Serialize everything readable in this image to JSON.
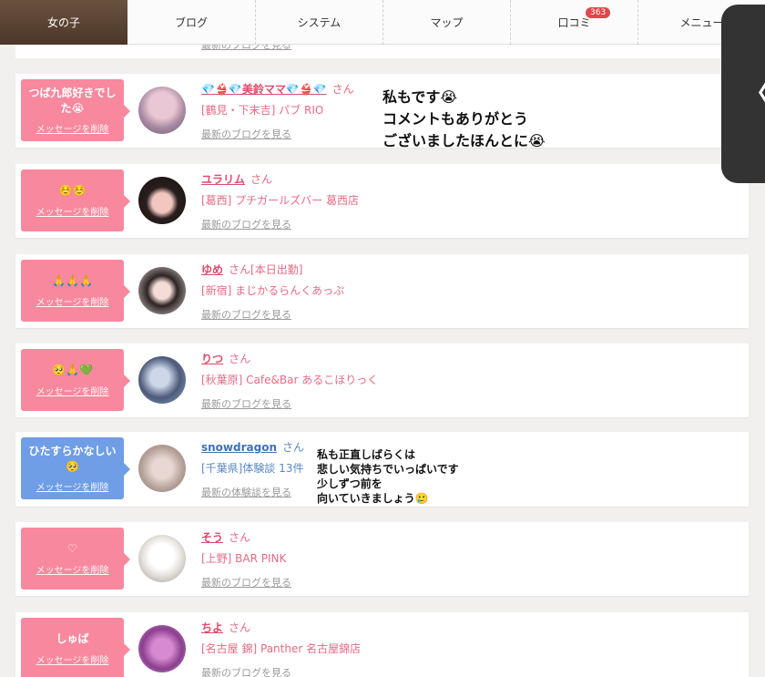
{
  "nav": {
    "tabs": [
      "女の子",
      "ブログ",
      "システム",
      "マップ",
      "口コミ",
      "メニュー"
    ],
    "review_badge": "363"
  },
  "side_handle": {
    "glyph": "〈"
  },
  "top_partial": {
    "blog_link": "最新のブログを見る"
  },
  "items": [
    {
      "message": "つば九郎好きでした😭",
      "delete": "メッセージを削除",
      "name": "💎👙💎美鈴ママ💎👙💎",
      "suffix": "さん",
      "status": "",
      "shop": "[鶴見・下末吉] パブ RIO",
      "blog": "最新のブログを見る",
      "bubble": "pink"
    },
    {
      "message": "☺️☺️",
      "delete": "メッセージを削除",
      "name": "ユラリム",
      "suffix": "さん",
      "status": "",
      "shop": "[葛西] プチガールズバー 葛西店",
      "blog": "最新のブログを見る",
      "bubble": "pink"
    },
    {
      "message": "🙏🙏🙏",
      "delete": "メッセージを削除",
      "name": "ゆめ",
      "suffix": "さん",
      "status": "[本日出勤]",
      "shop": "[新宿] まじかるらんくあっぷ",
      "blog": "最新のブログを見る",
      "bubble": "pink"
    },
    {
      "message": "🥺🙏💚",
      "delete": "メッセージを削除",
      "name": "りつ",
      "suffix": "さん",
      "status": "",
      "shop": "[秋葉原] Cafe&Bar あるこほりっく",
      "blog": "最新のブログを見る",
      "bubble": "pink"
    },
    {
      "message": "ひたすらかなしい🥺",
      "delete": "メッセージを削除",
      "name": "snowdragon",
      "suffix": "さん",
      "status": "",
      "shop": "[千葉県]体験談 13件",
      "blog": "最新の体験談を見る",
      "bubble": "blue"
    },
    {
      "message": "♡",
      "delete": "メッセージを削除",
      "name": "そう",
      "suffix": "さん",
      "status": "",
      "shop": "[上野] BAR PINK",
      "blog": "最新のブログを見る",
      "bubble": "pink"
    },
    {
      "message": "しゅば",
      "delete": "メッセージを削除",
      "name": "ちよ",
      "suffix": "さん",
      "status": "",
      "shop": "[名古屋 錦] Panther 名古屋錦店",
      "blog": "最新のブログを見る",
      "bubble": "pink"
    }
  ],
  "overlay_1": [
    "私もです😭",
    "コメントもありがとう",
    "ございましたほんとに😭"
  ],
  "overlay_2": [
    "私も正直しばらくは",
    "悲しい気持ちでいっぱいです",
    "少しずつ前を",
    "向いていきましょう🥲"
  ]
}
